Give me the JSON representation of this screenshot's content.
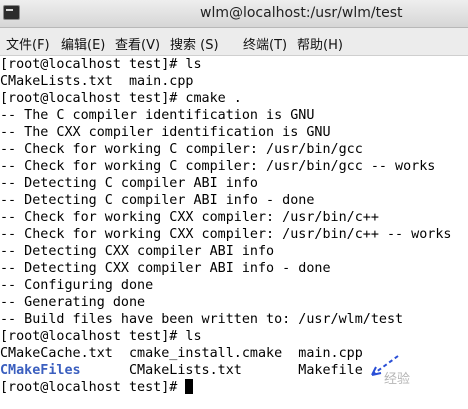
{
  "window": {
    "title": "wlm@localhost:/usr/wlm/test",
    "icon": "terminal-icon"
  },
  "menu": [
    {
      "label": "文件(F)"
    },
    {
      "label": "编辑(E)"
    },
    {
      "label": "查看(V)"
    },
    {
      "label": "搜索 (S)"
    },
    {
      "label": "终端(T)"
    },
    {
      "label": "帮助(H)"
    }
  ],
  "terminal": {
    "lines": [
      "[root@localhost test]# ls",
      "CMakeLists.txt  main.cpp",
      "[root@localhost test]# cmake .",
      "-- The C compiler identification is GNU",
      "-- The CXX compiler identification is GNU",
      "-- Check for working C compiler: /usr/bin/gcc",
      "-- Check for working C compiler: /usr/bin/gcc -- works",
      "-- Detecting C compiler ABI info",
      "-- Detecting C compiler ABI info - done",
      "-- Check for working CXX compiler: /usr/bin/c++",
      "-- Check for working CXX compiler: /usr/bin/c++ -- works",
      "-- Detecting CXX compiler ABI info",
      "-- Detecting CXX compiler ABI info - done",
      "-- Configuring done",
      "-- Generating done",
      "-- Build files have been written to: /usr/wlm/test",
      "[root@localhost test]# ls",
      "CMakeCache.txt  cmake_install.cmake  main.cpp"
    ],
    "ls_row": {
      "dir": "CMakeFiles",
      "gap": "      CMakeLists.txt       ",
      "file": "Makefile"
    },
    "prompt": "[root@localhost test]# ",
    "dir_color": "#3b5fbf"
  },
  "watermark": "经验"
}
